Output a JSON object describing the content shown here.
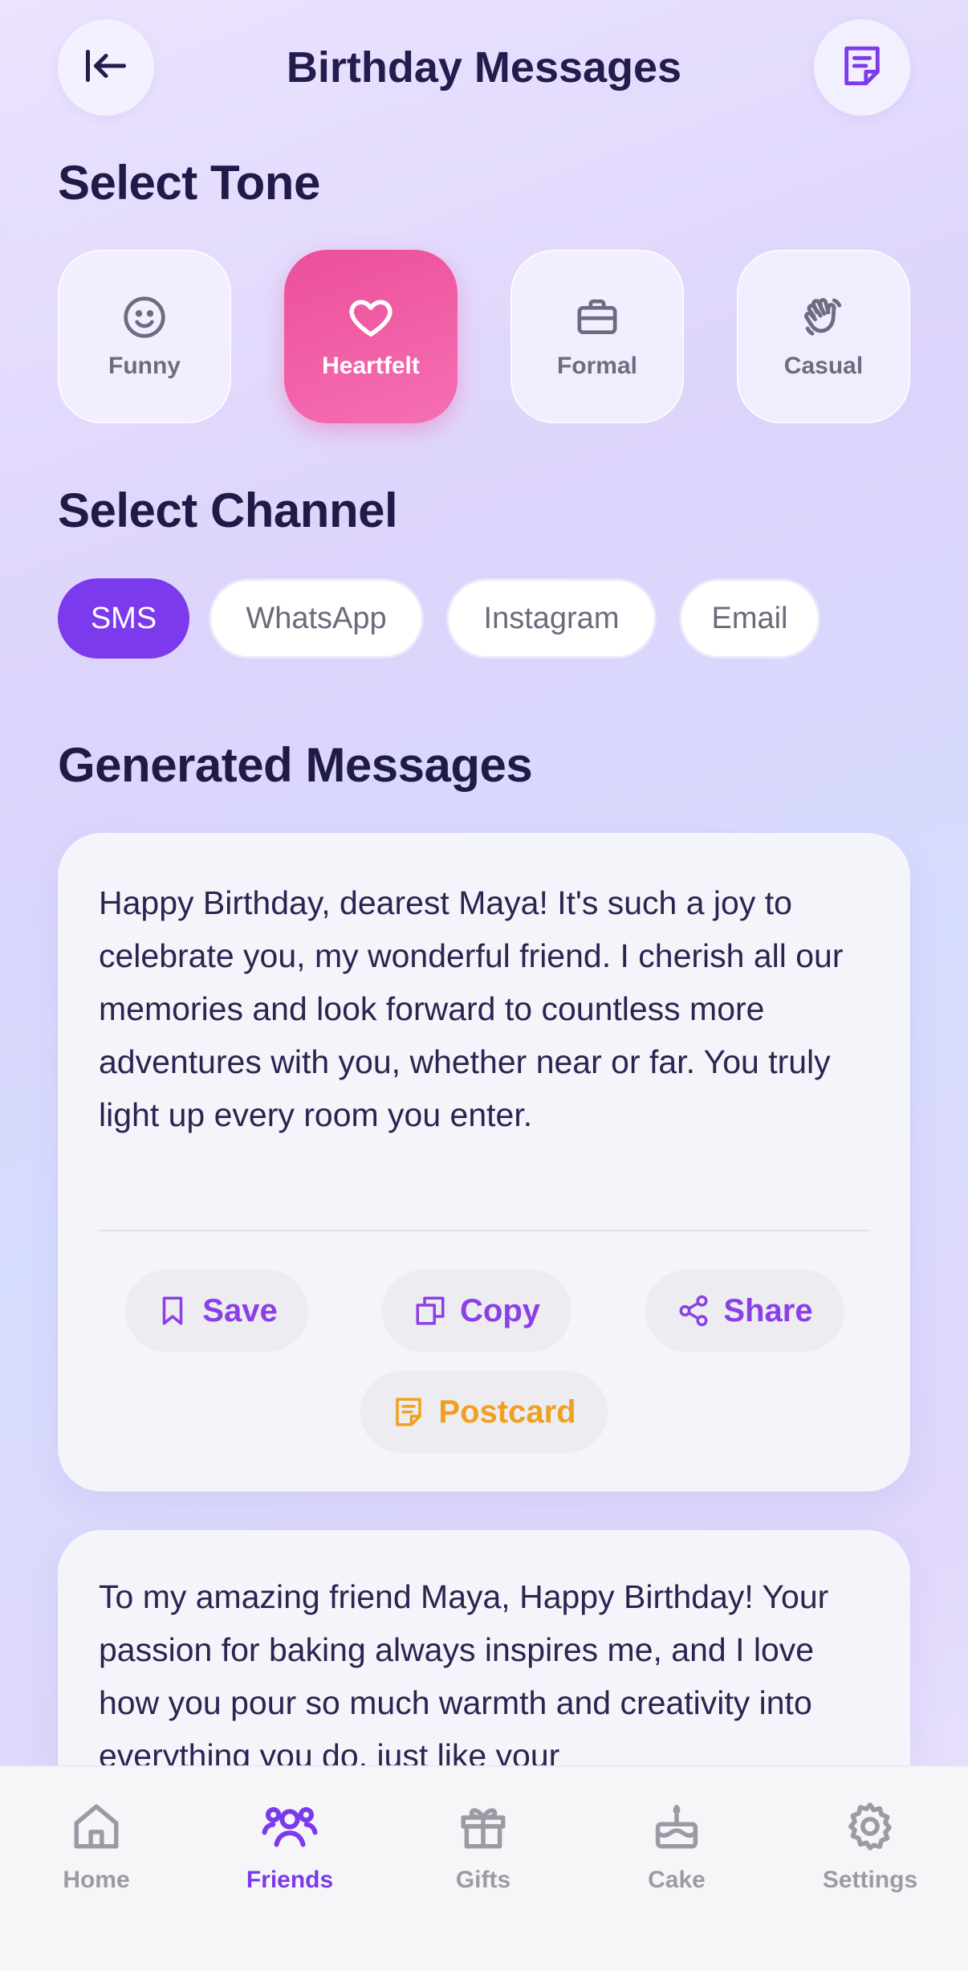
{
  "header": {
    "title": "Birthday Messages",
    "back_icon": "arrow-left-icon",
    "notes_icon": "note-icon"
  },
  "tone": {
    "title": "Select Tone",
    "options": [
      {
        "label": "Funny",
        "icon": "smile-icon",
        "selected": false
      },
      {
        "label": "Heartfelt",
        "icon": "heart-icon",
        "selected": true
      },
      {
        "label": "Formal",
        "icon": "briefcase-icon",
        "selected": false
      },
      {
        "label": "Casual",
        "icon": "waving-hand-icon",
        "selected": false
      }
    ]
  },
  "channel": {
    "title": "Select Channel",
    "options": [
      {
        "label": "SMS",
        "selected": true
      },
      {
        "label": "WhatsApp",
        "selected": false
      },
      {
        "label": "Instagram",
        "selected": false
      },
      {
        "label": "Email",
        "selected": false
      }
    ]
  },
  "messages": {
    "title": "Generated Messages",
    "items": [
      {
        "text": "Happy Birthday, dearest Maya! It's such a joy to celebrate you, my wonderful friend. I cherish all our memories and look forward to countless more adventures with you, whether near or far. You truly light up every room you enter."
      },
      {
        "text": "To my amazing friend Maya, Happy Birthday! Your passion for baking always inspires me, and I love how you pour so much warmth and creativity into everything you do, just like your"
      }
    ],
    "actions": {
      "save": "Save",
      "copy": "Copy",
      "share": "Share",
      "postcard": "Postcard"
    }
  },
  "nav": {
    "items": [
      {
        "label": "Home",
        "icon": "home-icon",
        "active": false
      },
      {
        "label": "Friends",
        "icon": "friends-icon",
        "active": true
      },
      {
        "label": "Gifts",
        "icon": "gift-icon",
        "active": false
      },
      {
        "label": "Cake",
        "icon": "cake-icon",
        "active": false
      },
      {
        "label": "Settings",
        "icon": "gear-icon",
        "active": false
      }
    ]
  },
  "colors": {
    "accent": "#7c3aed",
    "heartfelt": "#ec4f99",
    "postcard": "#f0a020",
    "text": "#231c4d"
  }
}
